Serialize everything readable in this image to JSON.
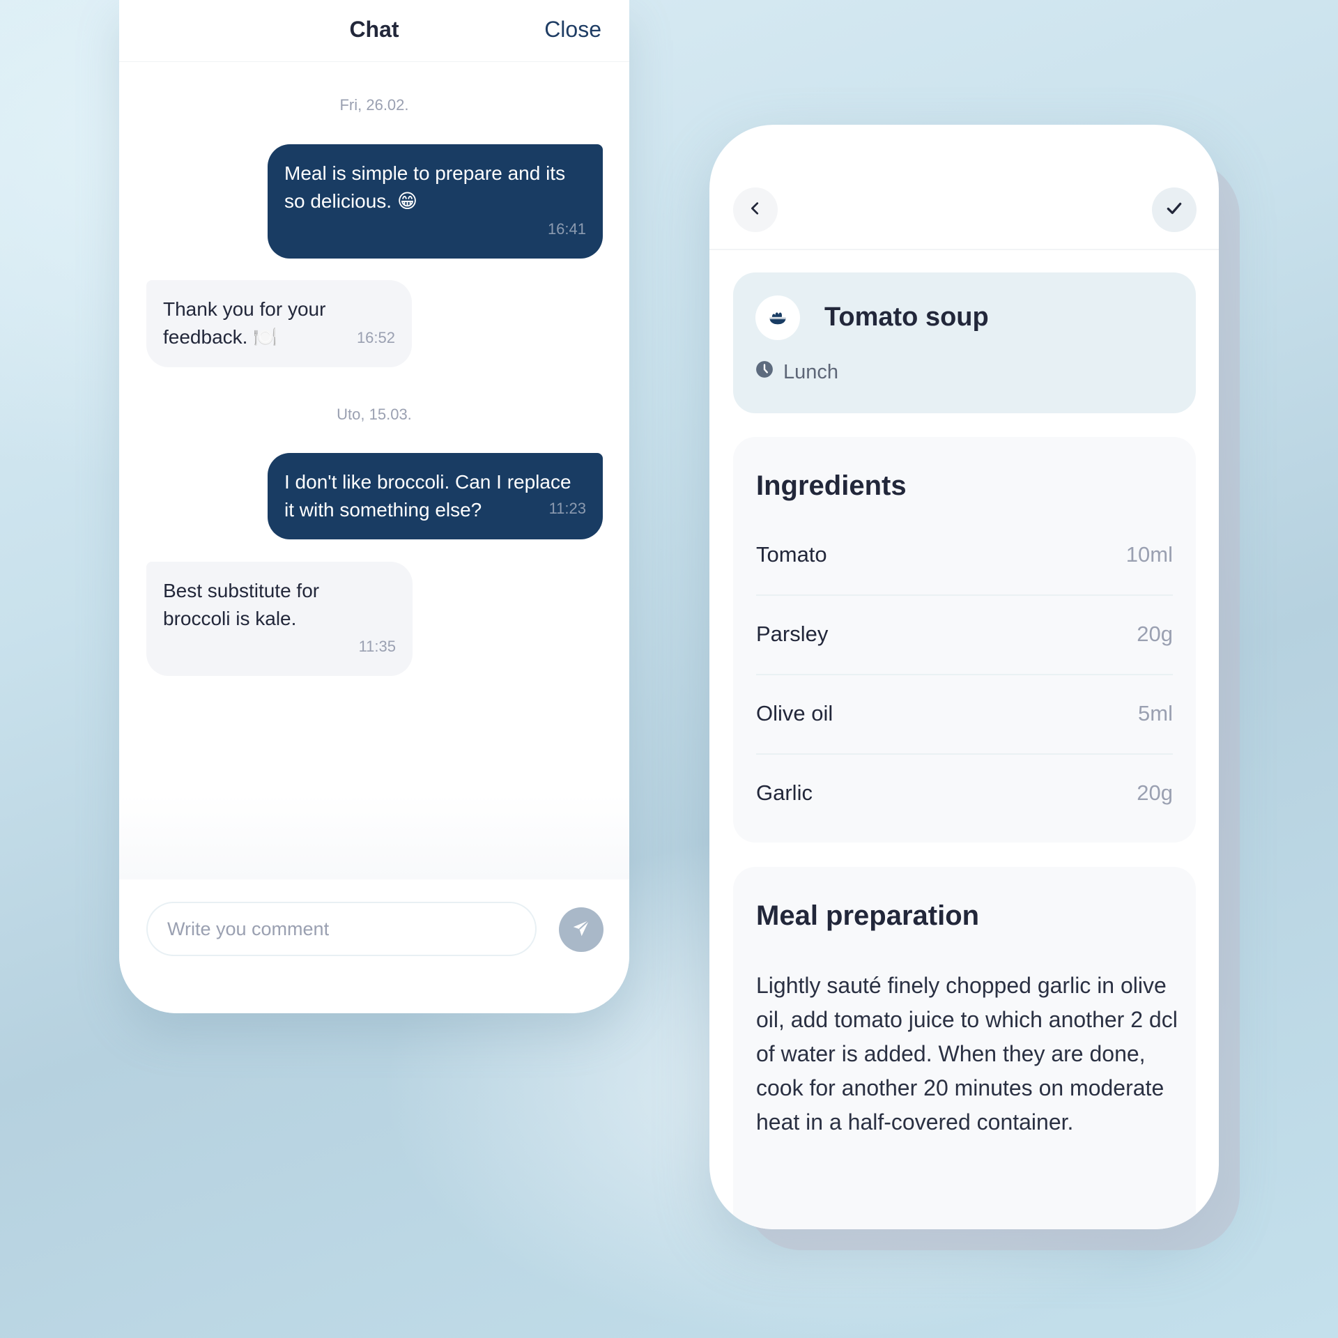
{
  "chat": {
    "title": "Chat",
    "close_label": "Close",
    "messages": [
      {
        "type": "date",
        "text": "Fri, 26.02."
      },
      {
        "type": "outgoing",
        "text": "Meal is simple to prepare and its so delicious. 😁",
        "time": "16:41"
      },
      {
        "type": "incoming",
        "text": "Thank you for your feedback. 🍽️",
        "time": "16:52"
      },
      {
        "type": "date",
        "text": "Uto, 15.03."
      },
      {
        "type": "outgoing",
        "text": "I don't like broccoli. Can I replace it with something else?",
        "time": "11:23"
      },
      {
        "type": "incoming",
        "text": "Best substitute for broccoli is kale.",
        "time": "11:35"
      }
    ],
    "input": {
      "placeholder": "Write you comment",
      "value": ""
    },
    "send_icon": "paper-plane-icon"
  },
  "recipe": {
    "back_icon": "chevron-left-icon",
    "confirm_icon": "checkmark-icon",
    "meal": {
      "icon": "salad-bowl-icon",
      "title": "Tomato soup",
      "time_icon": "clock-icon",
      "meal_type": "Lunch"
    },
    "ingredients": {
      "title": "Ingredients",
      "items": [
        {
          "name": "Tomato",
          "qty": "10ml"
        },
        {
          "name": "Parsley",
          "qty": "20g"
        },
        {
          "name": "Olive oil",
          "qty": "5ml"
        },
        {
          "name": "Garlic",
          "qty": "20g"
        }
      ]
    },
    "preparation": {
      "title": "Meal preparation",
      "text": "Lightly sauté finely chopped garlic in olive oil, add tomato juice to which another 2 dcl of water is added. When they are done, cook for another 20 minutes on moderate heat in a half-covered container."
    }
  },
  "colors": {
    "navy": "#193c63",
    "incoming_bubble": "#f4f5f8",
    "meal_card": "#e7f0f4",
    "muted_text": "#9aa0b1",
    "send_button": "#a9b8c8"
  }
}
